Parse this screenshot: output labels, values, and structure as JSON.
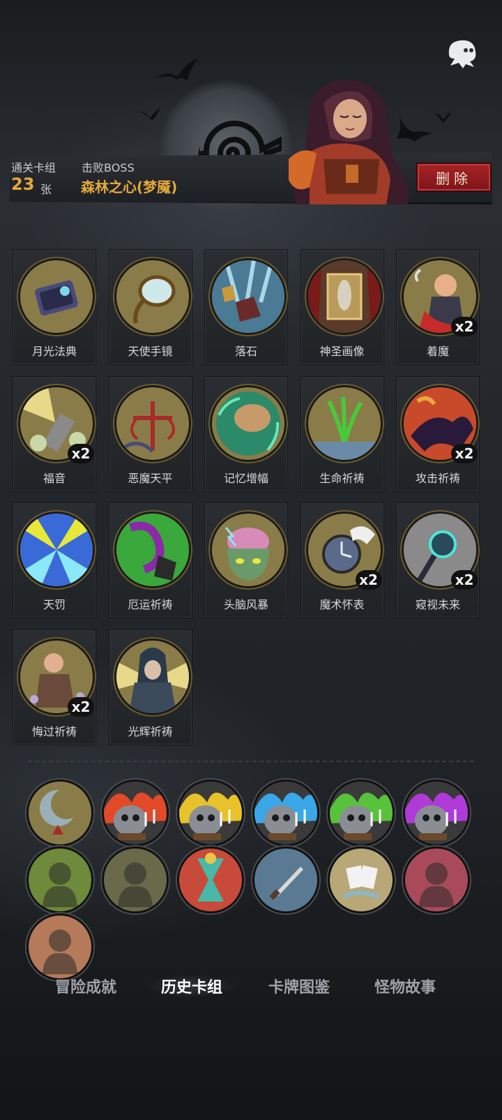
{
  "header": {
    "cleared_deck_label": "通关卡组",
    "card_count": "23",
    "card_unit": "张",
    "boss_label": "击败BOSS",
    "boss_name": "森林之心(梦魇)",
    "delete_label": "删除"
  },
  "cards": [
    {
      "name": "月光法典",
      "count": "",
      "art": "tome"
    },
    {
      "name": "天使手镜",
      "count": "",
      "art": "mirror"
    },
    {
      "name": "落石",
      "count": "",
      "art": "rocks"
    },
    {
      "name": "神圣画像",
      "count": "",
      "art": "portrait"
    },
    {
      "name": "着魔",
      "count": "x2",
      "art": "possessed"
    },
    {
      "name": "福音",
      "count": "x2",
      "art": "gospel"
    },
    {
      "name": "恶魔天平",
      "count": "",
      "art": "scale"
    },
    {
      "name": "记忆增幅",
      "count": "",
      "art": "brain-glow"
    },
    {
      "name": "生命祈祷",
      "count": "",
      "art": "sprout"
    },
    {
      "name": "攻击祈祷",
      "count": "x2",
      "art": "attack"
    },
    {
      "name": "天罚",
      "count": "",
      "art": "lightning"
    },
    {
      "name": "厄运祈祷",
      "count": "",
      "art": "doom"
    },
    {
      "name": "头脑风暴",
      "count": "",
      "art": "brainstorm"
    },
    {
      "name": "魔术怀表",
      "count": "x2",
      "art": "watch"
    },
    {
      "name": "窥视未来",
      "count": "x2",
      "art": "staff"
    },
    {
      "name": "悔过祈祷",
      "count": "x2",
      "art": "monk"
    },
    {
      "name": "光辉祈祷",
      "count": "",
      "art": "radiance"
    }
  ],
  "relics": [
    {
      "icon": "moon-relic-icon",
      "color": "#8a7c48"
    },
    {
      "icon": "red-flame-skull-icon",
      "color": "#e24a2a"
    },
    {
      "icon": "yellow-flame-skull-icon",
      "color": "#e8c22a"
    },
    {
      "icon": "blue-flame-skull-icon",
      "color": "#3aa7e8"
    },
    {
      "icon": "green-flame-skull-icon",
      "color": "#58c23a"
    },
    {
      "icon": "purple-flame-skull-icon",
      "color": "#b03ad8"
    },
    {
      "icon": "ghost-ogre-icon",
      "color": "#6e8a3a"
    },
    {
      "icon": "priest-icon",
      "color": "#6a6a4a"
    },
    {
      "icon": "hourglass-icon",
      "color": "#c84a3a"
    },
    {
      "icon": "dagger-icon",
      "color": "#5a7a94"
    },
    {
      "icon": "card-hand-icon",
      "color": "#b8a878"
    },
    {
      "icon": "gargoyle-icon",
      "color": "#a84a5a"
    },
    {
      "icon": "brute-icon",
      "color": "#b47a5a"
    }
  ],
  "tabs": [
    {
      "label": "冒险成就",
      "active": false
    },
    {
      "label": "历史卡组",
      "active": true
    },
    {
      "label": "卡牌图鉴",
      "active": false
    },
    {
      "label": "怪物故事",
      "active": false
    }
  ]
}
